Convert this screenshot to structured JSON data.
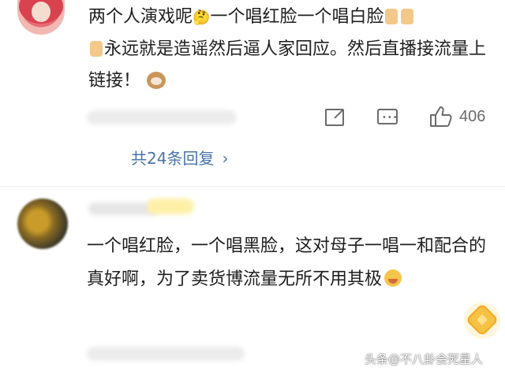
{
  "comment1": {
    "text_a": "两个人演戏呢",
    "text_b": "一个唱红脸一个唱白脸",
    "text_c": "永远就是造谣然后逼人家回应。然后直播接流量上链接！",
    "icons": [
      "thinking-emoji",
      "thumbs-up-emoji",
      "cat-emoji"
    ],
    "like_count": "406",
    "replies_label": "共24条回复",
    "replies_chevron": "›"
  },
  "comment2": {
    "text": "一个唱红脸，一个唱黑脸，这对母子一唱一和配合的真好啊，为了卖货博流量无所不用其极",
    "icons": [
      "crying-emoji",
      "gem-badge-icon"
    ]
  },
  "watermark": "头条@不八卦会死星人",
  "colors": {
    "link": "#4a74a8",
    "meta_gray": "#6b6b6b",
    "text": "#1e1e1e"
  }
}
